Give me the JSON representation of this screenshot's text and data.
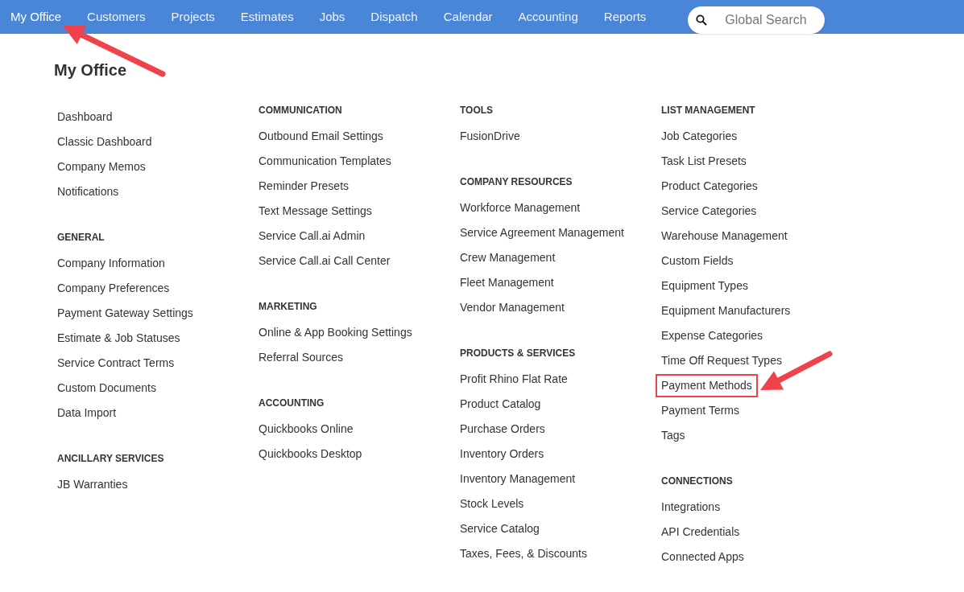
{
  "nav": {
    "items": [
      {
        "label": "My Office",
        "selected": true
      },
      {
        "label": "Customers",
        "selected": false
      },
      {
        "label": "Projects",
        "selected": false
      },
      {
        "label": "Estimates",
        "selected": false
      },
      {
        "label": "Jobs",
        "selected": false
      },
      {
        "label": "Dispatch",
        "selected": false
      },
      {
        "label": "Calendar",
        "selected": false
      },
      {
        "label": "Accounting",
        "selected": false
      },
      {
        "label": "Reports",
        "selected": false
      }
    ],
    "search": {
      "placeholder": "Global Search"
    }
  },
  "page_title": "My Office",
  "columns": [
    [
      {
        "items": [
          {
            "label": "Dashboard",
            "highlighted": false
          },
          {
            "label": "Classic Dashboard",
            "highlighted": false
          },
          {
            "label": "Company Memos",
            "highlighted": false
          },
          {
            "label": "Notifications",
            "highlighted": false
          }
        ]
      },
      {
        "heading": "GENERAL",
        "items": [
          {
            "label": "Company Information",
            "highlighted": false
          },
          {
            "label": "Company Preferences",
            "highlighted": false
          },
          {
            "label": "Payment Gateway Settings",
            "highlighted": false
          },
          {
            "label": "Estimate & Job Statuses",
            "highlighted": false
          },
          {
            "label": "Service Contract Terms",
            "highlighted": false
          },
          {
            "label": "Custom Documents",
            "highlighted": false
          },
          {
            "label": "Data Import",
            "highlighted": false
          }
        ]
      },
      {
        "heading": "ANCILLARY SERVICES",
        "items": [
          {
            "label": "JB Warranties",
            "highlighted": false
          }
        ]
      }
    ],
    [
      {
        "heading": "COMMUNICATION",
        "items": [
          {
            "label": "Outbound Email Settings",
            "highlighted": false
          },
          {
            "label": "Communication Templates",
            "highlighted": false
          },
          {
            "label": "Reminder Presets",
            "highlighted": false
          },
          {
            "label": "Text Message Settings",
            "highlighted": false
          },
          {
            "label": "Service Call.ai Admin",
            "highlighted": false
          },
          {
            "label": "Service Call.ai Call Center",
            "highlighted": false
          }
        ]
      },
      {
        "heading": "MARKETING",
        "items": [
          {
            "label": "Online & App Booking Settings",
            "highlighted": false
          },
          {
            "label": "Referral Sources",
            "highlighted": false
          }
        ]
      },
      {
        "heading": "ACCOUNTING",
        "items": [
          {
            "label": "Quickbooks Online",
            "highlighted": false
          },
          {
            "label": "Quickbooks Desktop",
            "highlighted": false
          }
        ]
      }
    ],
    [
      {
        "heading": "TOOLS",
        "items": [
          {
            "label": "FusionDrive",
            "highlighted": false
          }
        ]
      },
      {
        "heading": "COMPANY RESOURCES",
        "items": [
          {
            "label": "Workforce Management",
            "highlighted": false
          },
          {
            "label": "Service Agreement Management",
            "highlighted": false
          },
          {
            "label": "Crew Management",
            "highlighted": false
          },
          {
            "label": "Fleet Management",
            "highlighted": false
          },
          {
            "label": "Vendor Management",
            "highlighted": false
          }
        ]
      },
      {
        "heading": "PRODUCTS & SERVICES",
        "items": [
          {
            "label": "Profit Rhino Flat Rate",
            "highlighted": false
          },
          {
            "label": "Product Catalog",
            "highlighted": false
          },
          {
            "label": "Purchase Orders",
            "highlighted": false
          },
          {
            "label": "Inventory Orders",
            "highlighted": false
          },
          {
            "label": "Inventory Management",
            "highlighted": false
          },
          {
            "label": "Stock Levels",
            "highlighted": false
          },
          {
            "label": "Service Catalog",
            "highlighted": false
          },
          {
            "label": "Taxes, Fees, & Discounts",
            "highlighted": false
          }
        ]
      }
    ],
    [
      {
        "heading": "LIST MANAGEMENT",
        "items": [
          {
            "label": "Job Categories",
            "highlighted": false
          },
          {
            "label": "Task List Presets",
            "highlighted": false
          },
          {
            "label": "Product Categories",
            "highlighted": false
          },
          {
            "label": "Service Categories",
            "highlighted": false
          },
          {
            "label": "Warehouse Management",
            "highlighted": false
          },
          {
            "label": "Custom Fields",
            "highlighted": false
          },
          {
            "label": "Equipment Types",
            "highlighted": false
          },
          {
            "label": "Equipment Manufacturers",
            "highlighted": false
          },
          {
            "label": "Expense Categories",
            "highlighted": false
          },
          {
            "label": "Time Off Request Types",
            "highlighted": false
          },
          {
            "label": "Payment Methods",
            "highlighted": true
          },
          {
            "label": "Payment Terms",
            "highlighted": false
          },
          {
            "label": "Tags",
            "highlighted": false
          }
        ]
      },
      {
        "heading": "CONNECTIONS",
        "items": [
          {
            "label": "Integrations",
            "highlighted": false
          },
          {
            "label": "API Credentials",
            "highlighted": false
          },
          {
            "label": "Connected Apps",
            "highlighted": false
          }
        ]
      }
    ]
  ]
}
